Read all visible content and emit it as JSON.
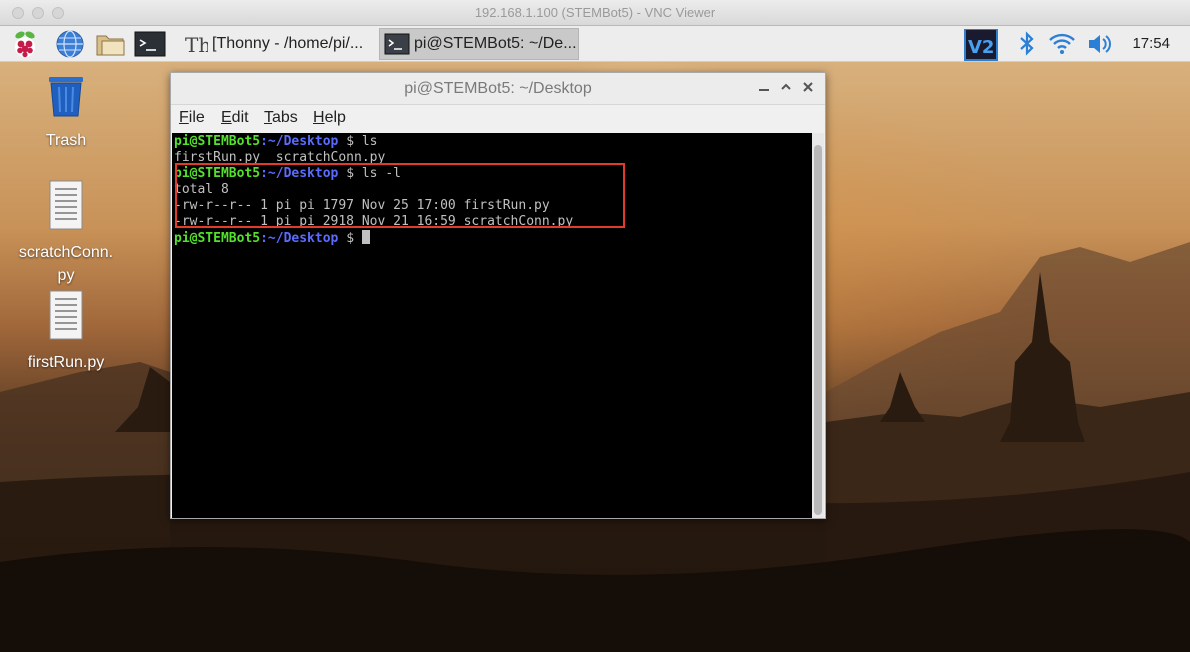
{
  "vnc": {
    "title": "192.168.1.100 (STEMBot5) - VNC Viewer"
  },
  "panel": {
    "tasks": [
      {
        "label": "[Thonny  -  /home/pi/...",
        "icon": "thonny-icon"
      },
      {
        "label": "pi@STEMBot5: ~/De...",
        "icon": "terminal-icon"
      }
    ],
    "clock": "17:54",
    "launcher_icons": [
      "raspberry-menu-icon",
      "web-browser-icon",
      "file-manager-icon",
      "terminal-icon"
    ],
    "tray_icons": [
      "vnc-icon",
      "bluetooth-icon",
      "wifi-icon",
      "volume-icon"
    ]
  },
  "desktop": {
    "items": [
      {
        "label": "Trash",
        "icon": "trash-icon"
      },
      {
        "label": "scratchConn.py",
        "icon": "text-file-icon"
      },
      {
        "label": "firstRun.py",
        "icon": "text-file-icon"
      }
    ]
  },
  "terminal": {
    "title": "pi@STEMBot5: ~/Desktop",
    "menu": [
      "File",
      "Edit",
      "Tabs",
      "Help"
    ],
    "prompt_user": "pi@STEMBot5",
    "prompt_path": "~/Desktop",
    "lines": [
      {
        "type": "prompt",
        "cmd": "ls"
      },
      {
        "type": "output",
        "text": "firstRun.py  scratchConn.py"
      },
      {
        "type": "prompt",
        "cmd": "ls -l"
      },
      {
        "type": "output",
        "text": "total 8"
      },
      {
        "type": "output",
        "text": "-rw-r--r-- 1 pi pi 1797 Nov 25 17:00 firstRun.py"
      },
      {
        "type": "output",
        "text": "-rw-r--r-- 1 pi pi 2918 Nov 21 16:59 scratchConn.py"
      },
      {
        "type": "prompt",
        "cmd": "",
        "cursor": true
      }
    ]
  },
  "colors": {
    "highlight": "#e23b2a",
    "prompt_user": "#54e12b",
    "prompt_path": "#5a6cff"
  }
}
